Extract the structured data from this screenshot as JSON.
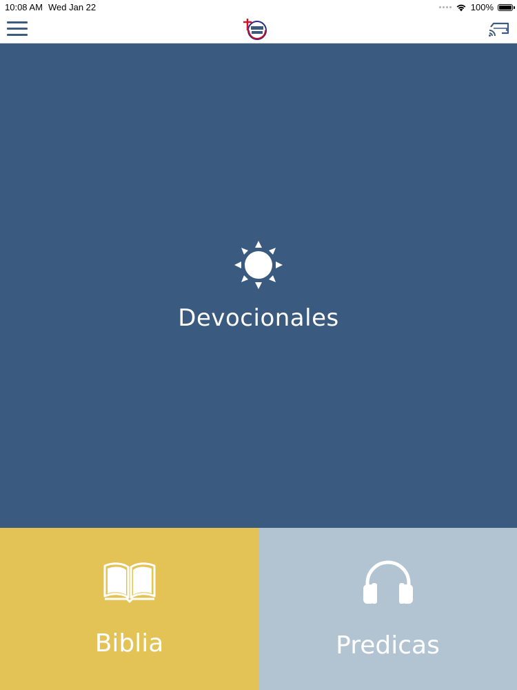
{
  "status_bar": {
    "time": "10:08 AM",
    "date": "Wed Jan 22",
    "battery": "100%",
    "battery_level": 1.0
  },
  "nav": {
    "menu_icon": "hamburger-menu-icon",
    "logo_icon": "church-logo-icon",
    "cast_icon": "cast-icon"
  },
  "tiles": {
    "devocionales": {
      "label": "Devocionales",
      "icon": "sun-icon",
      "color": "#3b5a80"
    },
    "biblia": {
      "label": "Biblia",
      "icon": "open-book-icon",
      "color": "#e3c355"
    },
    "predicas": {
      "label": "Predicas",
      "icon": "headphones-icon",
      "color": "#b2c3d1"
    }
  }
}
